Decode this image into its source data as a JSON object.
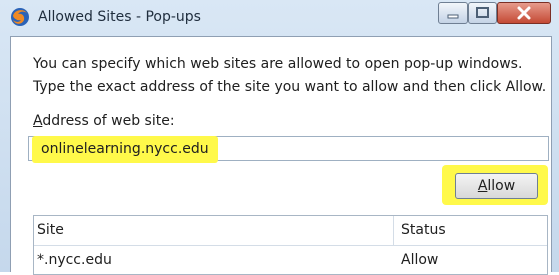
{
  "window": {
    "title": "Allowed Sites - Pop-ups",
    "minimize_icon": "minimize-icon",
    "maximize_icon": "maximize-icon",
    "close_icon": "close-icon",
    "app_icon": "firefox-icon"
  },
  "dialog": {
    "description": "You can specify which web sites are allowed to open pop-up windows. Type the exact address of the site you want to allow and then click Allow.",
    "address_label_prefix": "A",
    "address_label_rest": "ddress of web site:",
    "address_value": "onlinelearning.nycc.edu",
    "allow_prefix": "A",
    "allow_rest": "llow"
  },
  "table": {
    "columns": [
      "Site",
      "Status"
    ],
    "rows": [
      {
        "site": "*.nycc.edu",
        "status": "Allow"
      }
    ]
  },
  "colors": {
    "highlight": "#fff94a",
    "title_bar": "#d9e7f5",
    "close_button": "#c44a35"
  }
}
